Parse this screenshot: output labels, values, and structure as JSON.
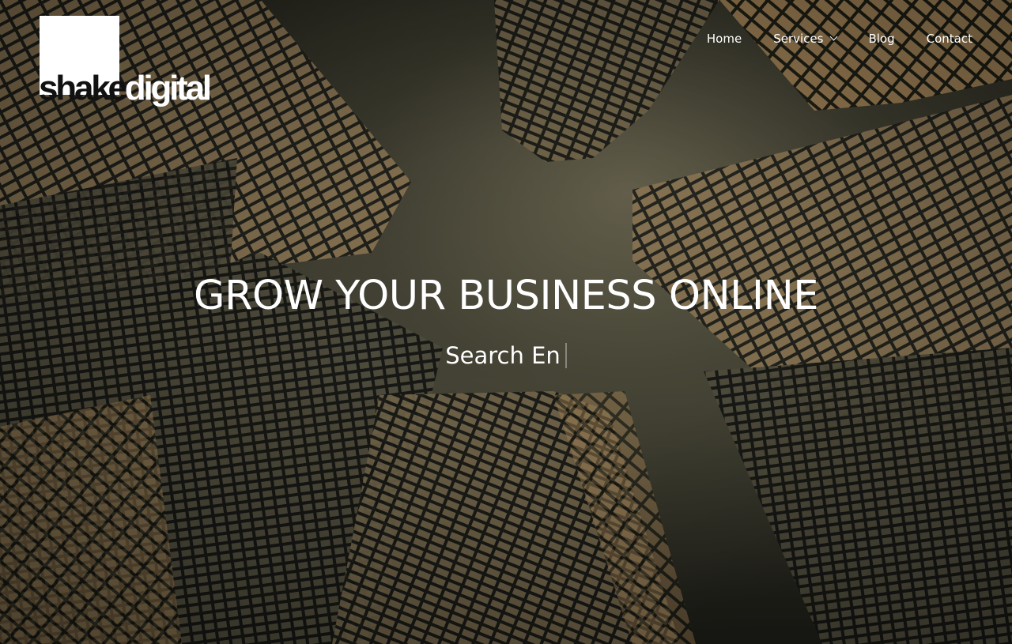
{
  "brand": {
    "logo_text_dark": "shake",
    "logo_text_light": "digital"
  },
  "nav": {
    "items": [
      {
        "label": "Home"
      },
      {
        "label": "Services",
        "has_dropdown": true,
        "icon": "chevron-down-icon"
      },
      {
        "label": "Blog"
      },
      {
        "label": "Contact"
      }
    ]
  },
  "hero": {
    "headline": "GROW YOUR BUSINESS ONLINE",
    "typed_text": "Search En"
  },
  "colors": {
    "text": "#ffffff",
    "logo_box": "#ffffff",
    "logo_dark": "#111111",
    "window_glow": "#c79a5e"
  }
}
